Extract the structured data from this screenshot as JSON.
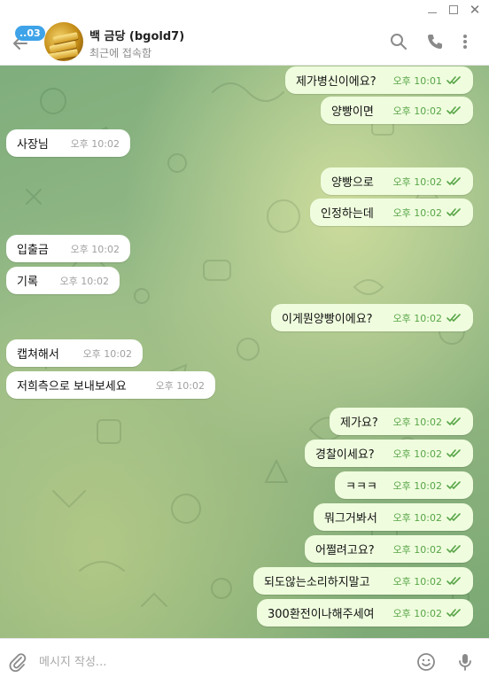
{
  "header": {
    "unread_badge": "..03",
    "chat_title": "백 금당 (bgold7)",
    "status": "최근에 접속함"
  },
  "messages": [
    {
      "dir": "out",
      "text": "제가병신이에요?",
      "time": "오후 10:01"
    },
    {
      "dir": "out",
      "text": "양빵이면",
      "time": "오후 10:02"
    },
    {
      "dir": "in",
      "text": "사장님",
      "time": "오후 10:02"
    },
    {
      "dir": "out",
      "text": "양빵으로",
      "time": "오후 10:02"
    },
    {
      "dir": "out",
      "text": "인정하는데",
      "time": "오후 10:02"
    },
    {
      "dir": "in",
      "text": "입출금",
      "time": "오후 10:02"
    },
    {
      "dir": "in",
      "text": "기록",
      "time": "오후 10:02"
    },
    {
      "dir": "out",
      "text": "이게뭔양빵이에요?",
      "time": "오후 10:02"
    },
    {
      "dir": "in",
      "text": "캡쳐해서",
      "time": "오후 10:02"
    },
    {
      "dir": "in",
      "text": "저희측으로 보내보세요",
      "time": "오후 10:02"
    },
    {
      "dir": "out",
      "text": "제가요?",
      "time": "오후 10:02"
    },
    {
      "dir": "out",
      "text": "경찰이세요?",
      "time": "오후 10:02"
    },
    {
      "dir": "out",
      "text": "ㅋㅋㅋ",
      "time": "오후 10:02"
    },
    {
      "dir": "out",
      "text": "뭐그거봐서",
      "time": "오후 10:02"
    },
    {
      "dir": "out",
      "text": "어쩔려고요?",
      "time": "오후 10:02"
    },
    {
      "dir": "out",
      "text": "되도않는소리하지말고",
      "time": "오후 10:02"
    },
    {
      "dir": "out",
      "text": "300환전이나해주세여",
      "time": "오후 10:02"
    }
  ],
  "composer": {
    "placeholder": "메시지 작성..."
  },
  "icons": {
    "back": "arrow-left-icon",
    "search": "search-icon",
    "call": "phone-icon",
    "menu": "more-vertical-icon",
    "attach": "paperclip-icon",
    "emoji": "smile-icon",
    "voice": "microphone-icon",
    "scroll": "chevron-down-icon",
    "read": "double-check-icon"
  },
  "colors": {
    "accent": "#3ea3e8",
    "outgoing_bubble": "#effdde",
    "incoming_bubble": "#ffffff",
    "read_check": "#59a548"
  }
}
